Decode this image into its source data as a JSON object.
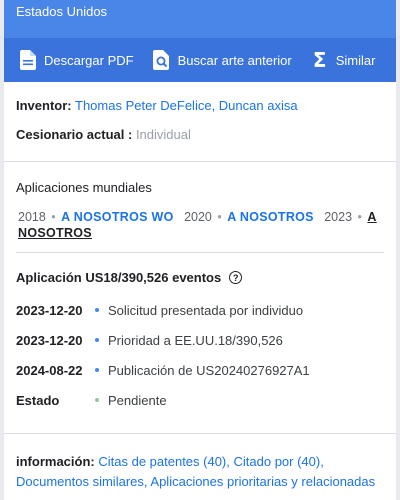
{
  "header": {
    "country": "Estados Unidos"
  },
  "toolbar": {
    "download_pdf": "Descargar PDF",
    "prior_art": "Buscar arte anterior",
    "similar": "Similar"
  },
  "people": {
    "inventor_label": "Inventor:",
    "inventor_value": "Thomas Peter DeFelice, Duncan axisa",
    "assignee_label": "Cesionario actual :",
    "assignee_value": "Individual"
  },
  "worldwide": {
    "title": "Aplicaciones mundiales",
    "items": [
      {
        "year": "2018",
        "code": "A NOSOTROS WO"
      },
      {
        "year": "2020",
        "code": "A NOSOTROS"
      },
      {
        "year": "2023",
        "code": "A NOSOTROS"
      }
    ]
  },
  "events": {
    "title": "Aplicación US18/390,526 eventos",
    "help_glyph": "?",
    "rows": [
      {
        "date": "2023-12-20",
        "text": "Solicitud presentada por individuo"
      },
      {
        "date": "2023-12-20",
        "text": "Prioridad a EE.UU.18/390,526"
      },
      {
        "date": "2024-08-22",
        "text": "Publicación de US20240276927A1"
      },
      {
        "date": "Estado",
        "text": "Pendiente"
      }
    ]
  },
  "info": {
    "label": "información:",
    "links": [
      "Citas de patentes (40)",
      "Citado por (40)",
      "Documentos similares",
      "Aplicaciones prioritarias y relacionadas"
    ]
  },
  "colors": {
    "banner": "#4a86e8",
    "toolbar": "#3a73dc",
    "link": "#1a73e8",
    "muted": "#9aa0a6"
  },
  "icons": [
    "pdf-document-icon",
    "search-document-icon",
    "sigma-icon",
    "help-icon"
  ]
}
